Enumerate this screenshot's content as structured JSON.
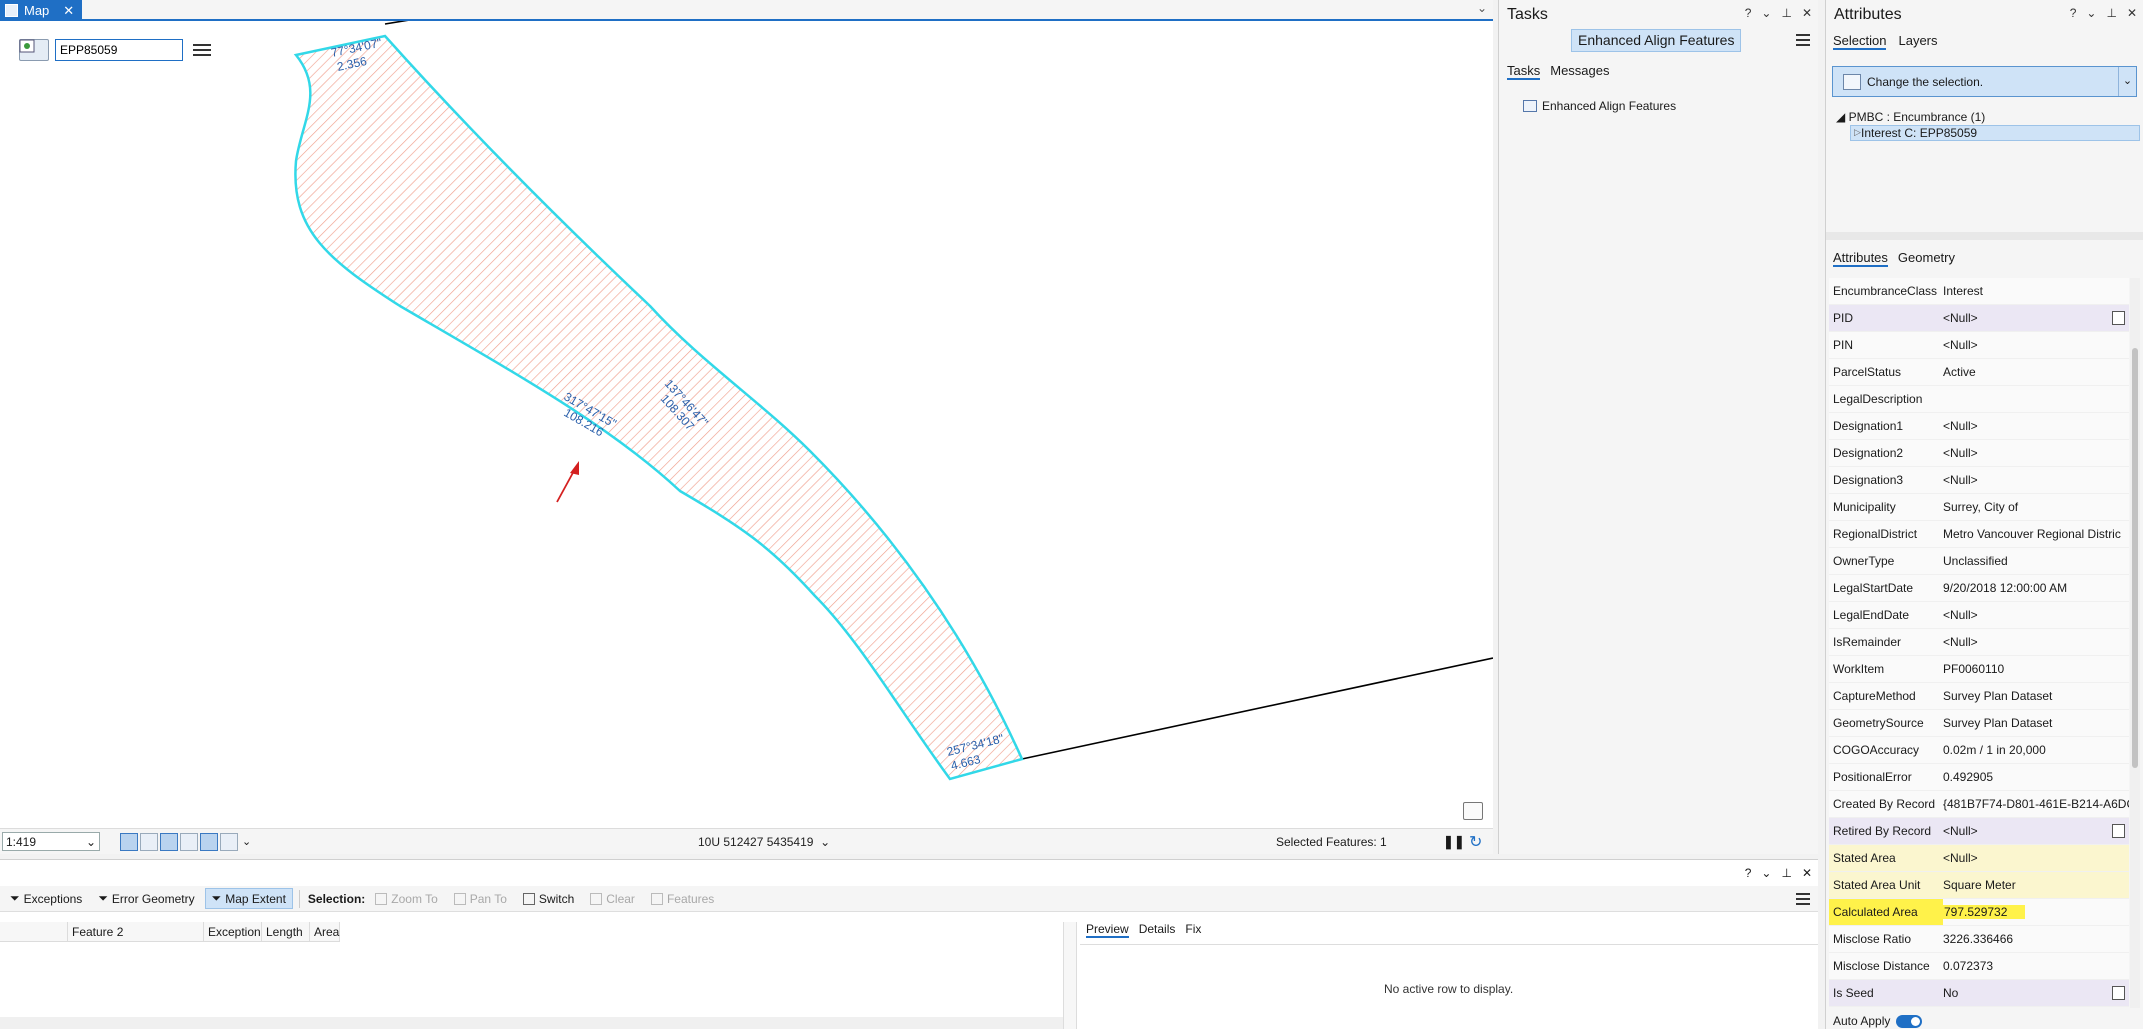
{
  "map": {
    "tab_label": "Map",
    "locator_value": "EPP85059",
    "scale": "1:419",
    "coordinates": "10U 512427 5435419",
    "selected_features": "Selected Features: 1",
    "labels": {
      "top_bearing": "77°34'07\"",
      "top_distance": "2.356",
      "left_bearing": "317°47'15\"",
      "left_distance": "108.216",
      "right_bearing": "137°46'47\"",
      "right_distance": "108.307",
      "bottom_bearing": "257°34'18\"",
      "bottom_distance": "4.663"
    }
  },
  "tasks": {
    "title": "Tasks",
    "task_name": "Enhanced Align Features",
    "tabs": [
      "Tasks",
      "Messages"
    ],
    "item": "Enhanced Align Features"
  },
  "attributes": {
    "title": "Attributes",
    "top_tabs": [
      "Selection",
      "Layers"
    ],
    "selection_tool_label": "Change the selection.",
    "tree_parent": "PMBC : Encumbrance (1)",
    "tree_child": "Interest  C: EPP85059",
    "bottom_tabs": [
      "Attributes",
      "Geometry"
    ],
    "rows": [
      {
        "name": "EncumbranceClass",
        "value": "Interest"
      },
      {
        "name": "PID",
        "value": "<Null>"
      },
      {
        "name": "PIN",
        "value": "<Null>"
      },
      {
        "name": "ParcelStatus",
        "value": "Active"
      },
      {
        "name": "LegalDescription",
        "value": ""
      },
      {
        "name": "Designation1",
        "value": "<Null>"
      },
      {
        "name": "Designation2",
        "value": "<Null>"
      },
      {
        "name": "Designation3",
        "value": "<Null>"
      },
      {
        "name": "Municipality",
        "value": "Surrey, City of"
      },
      {
        "name": "RegionalDistrict",
        "value": "Metro Vancouver Regional Distric"
      },
      {
        "name": "OwnerType",
        "value": "Unclassified"
      },
      {
        "name": "LegalStartDate",
        "value": "9/20/2018 12:00:00 AM"
      },
      {
        "name": "LegalEndDate",
        "value": "<Null>"
      },
      {
        "name": "IsRemainder",
        "value": "<Null>"
      },
      {
        "name": "WorkItem",
        "value": "PF0060110"
      },
      {
        "name": "CaptureMethod",
        "value": "Survey Plan Dataset"
      },
      {
        "name": "GeometrySource",
        "value": "Survey Plan Dataset"
      },
      {
        "name": "COGOAccuracy",
        "value": "0.02m / 1 in 20,000"
      },
      {
        "name": "PositionalError",
        "value": "0.492905"
      },
      {
        "name": "Created By Record",
        "value": "{481B7F74-D801-461E-B214-A6DC"
      },
      {
        "name": "Retired By Record",
        "value": "<Null>"
      },
      {
        "name": "Stated Area",
        "value": "<Null>"
      },
      {
        "name": "Stated Area Unit",
        "value": "Square Meter"
      },
      {
        "name": "Calculated Area",
        "value": "797.529732"
      },
      {
        "name": "Misclose Ratio",
        "value": "3226.336466"
      },
      {
        "name": "Misclose Distance",
        "value": "0.072373"
      },
      {
        "name": "Is Seed",
        "value": "No"
      }
    ],
    "auto_apply": "Auto Apply"
  },
  "bottom": {
    "toolbar": {
      "exceptions": "Exceptions",
      "error_geometry": "Error Geometry",
      "map_extent": "Map Extent",
      "selection_label": "Selection:",
      "zoom_to": "Zoom To",
      "pan_to": "Pan To",
      "switch": "Switch",
      "clear": "Clear",
      "features": "Features"
    },
    "grid_columns": [
      "",
      "Feature 2",
      "Exception",
      "Length",
      "Area"
    ],
    "preview_tabs": [
      "Preview",
      "Details",
      "Fix"
    ],
    "empty_message": "No active row to display."
  }
}
